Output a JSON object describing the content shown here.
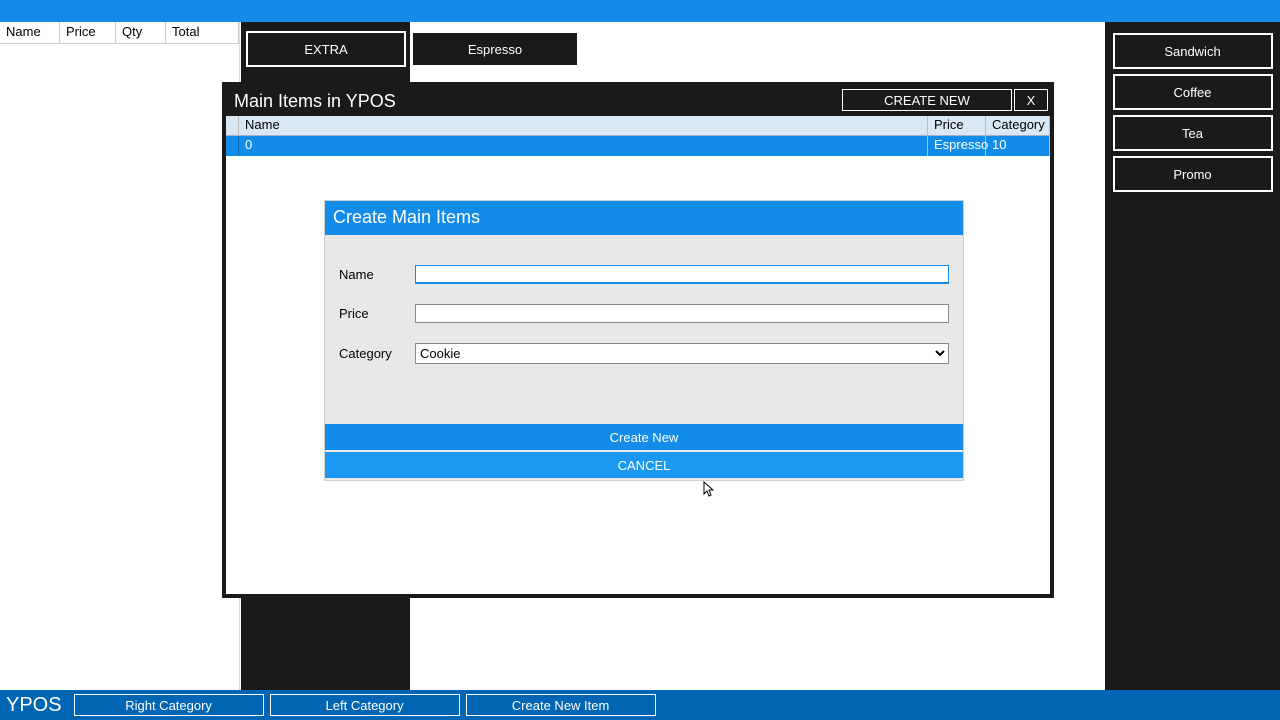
{
  "order_columns": {
    "name": "Name",
    "price": "Price",
    "qty": "Qty",
    "total": "Total"
  },
  "top_categories": {
    "extra": "EXTRA",
    "espresso": "Espresso"
  },
  "right_categories": [
    "Sandwich",
    "Coffee",
    "Tea",
    "Promo"
  ],
  "modal": {
    "title": "Main Items in YPOS",
    "create_new": "CREATE NEW",
    "close": "X",
    "columns": {
      "name": "Name",
      "price": "Price",
      "category": "Category"
    },
    "row": {
      "id": "0",
      "price": "Espresso",
      "category": "10"
    }
  },
  "form": {
    "title": "Create Main Items",
    "labels": {
      "name": "Name",
      "price": "Price",
      "category": "Category"
    },
    "category_value": "Cookie",
    "actions": {
      "create": "Create New",
      "cancel": "CANCEL"
    }
  },
  "footer": {
    "brand": "YPOS",
    "buttons": [
      "Right Category",
      "Left Category",
      "Create New Item"
    ]
  }
}
